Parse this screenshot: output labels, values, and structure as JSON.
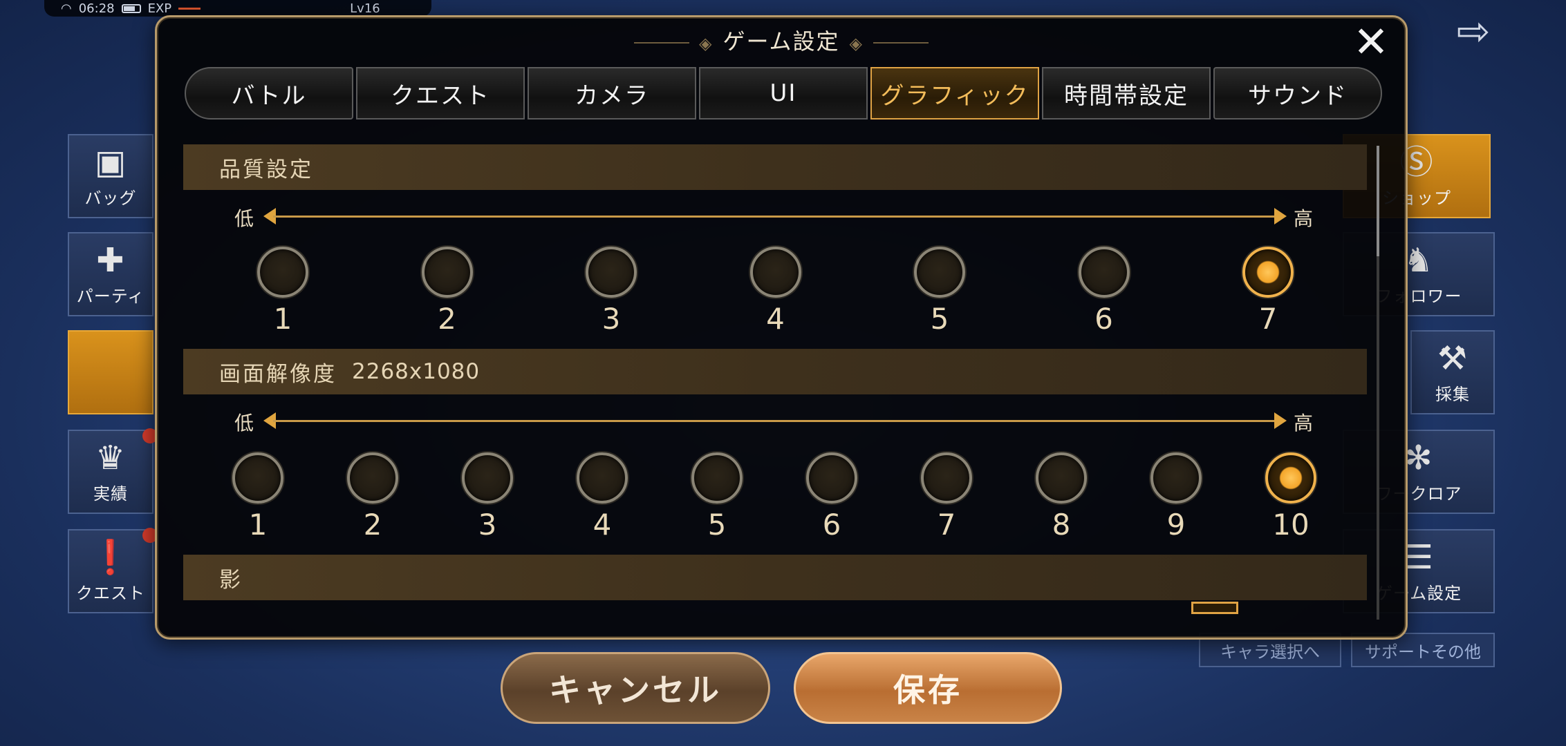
{
  "status_bar": {
    "time": "06:28",
    "exp_label": "EXP",
    "level": "Lv16"
  },
  "background_menu": {
    "left": [
      {
        "label": "バッグ",
        "icon": "bag-icon"
      },
      {
        "label": "パーティ",
        "icon": "party-icon"
      },
      {
        "label": "",
        "icon": "blank"
      },
      {
        "label": "実績",
        "icon": "crown-icon"
      },
      {
        "label": "クエスト",
        "icon": "quest-icon"
      }
    ],
    "right": [
      {
        "label": "ショップ",
        "icon": "shop-icon"
      },
      {
        "label": "フォロワー",
        "icon": "follower-icon"
      },
      {
        "label": "採集",
        "icon": "gather-icon"
      },
      {
        "label": "ワークロア",
        "icon": "worklore-icon"
      },
      {
        "label": "ゲーム設定",
        "icon": "settings-icon"
      }
    ],
    "bottom_right_buttons": [
      "キャラ選択へ",
      "サポートその他"
    ]
  },
  "modal": {
    "title": "ゲーム設定",
    "tabs": [
      {
        "label": "バトル"
      },
      {
        "label": "クエスト"
      },
      {
        "label": "カメラ"
      },
      {
        "label": "UI"
      },
      {
        "label": "グラフィック",
        "active": true
      },
      {
        "label": "時間帯設定"
      },
      {
        "label": "サウンド"
      }
    ],
    "quality": {
      "header": "品質設定",
      "low": "低",
      "high": "高",
      "options": [
        "1",
        "2",
        "3",
        "4",
        "5",
        "6",
        "7"
      ],
      "selected": "7"
    },
    "resolution": {
      "header": "画面解像度",
      "value": "2268x1080",
      "low": "低",
      "high": "高",
      "options": [
        "1",
        "2",
        "3",
        "4",
        "5",
        "6",
        "7",
        "8",
        "9",
        "10"
      ],
      "selected": "10"
    },
    "shadow": {
      "header": "影"
    }
  },
  "buttons": {
    "cancel": "キャンセル",
    "save": "保存"
  },
  "colors": {
    "accent": "#e0a344",
    "selected_knob": "#f3a52a",
    "save_button": "#c98347",
    "cancel_button": "#6e5236"
  }
}
